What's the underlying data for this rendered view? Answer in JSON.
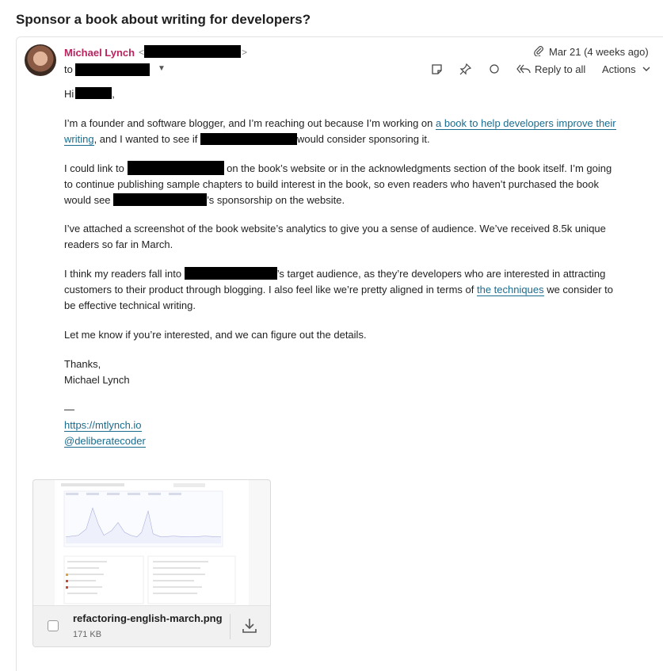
{
  "subject": "Sponsor a book about writing for developers?",
  "sender": {
    "name": "Michael Lynch",
    "avatar_icon": "person-photo"
  },
  "recipient": {
    "to_label": "to"
  },
  "header": {
    "date": "Mar 21 (4 weeks ago)",
    "reply_label": "Reply to all",
    "actions_label": "Actions",
    "icons": [
      "paperclip-icon",
      "note-icon",
      "pin-icon",
      "circle-icon",
      "reply-all-icon",
      "chevron-down-icon"
    ]
  },
  "body": {
    "greeting_start": "Hi",
    "greeting_end": ",",
    "p1_a": "I’m a founder and software blogger, and I’m reaching out because I’m working on ",
    "p1_link": "a book to help developers improve their writing",
    "p1_b": ", and I wanted to see if ",
    "p1_c": "would consider sponsoring it.",
    "p2_a": "I could link to ",
    "p2_b": " on the book’s website or in the acknowledgments section of the book itself. I’m going to continue publishing sample chapters to build interest in the book, so even readers who haven’t purchased the book would see ",
    "p2_c": "’s sponsorship on the website.",
    "p3": "I’ve attached a screenshot of the book website’s analytics to give you a sense of audience. We’ve received 8.5k unique readers so far in March.",
    "p4_a": "I think my readers fall into ",
    "p4_b": "’s target audience, as they’re developers who are interested in attracting customers to their product through blogging. I also feel like we’re pretty aligned in terms of ",
    "p4_link": "the techniques",
    "p4_c": " we consider to be effective technical writing.",
    "p5": "Let me know if you’re interested, and we can figure out the details.",
    "signoff": "Thanks,",
    "signature": "Michael Lynch",
    "dash": "—",
    "sig_link1": "https://mtlynch.io",
    "sig_link2": "@deliberatecoder"
  },
  "attachment": {
    "filename": "refactoring-english-march.png",
    "size": "171 KB",
    "download_icon": "download-icon"
  },
  "colors": {
    "sender": "#b8255f",
    "link": "#1a6c8f",
    "redaction": "#000000"
  }
}
